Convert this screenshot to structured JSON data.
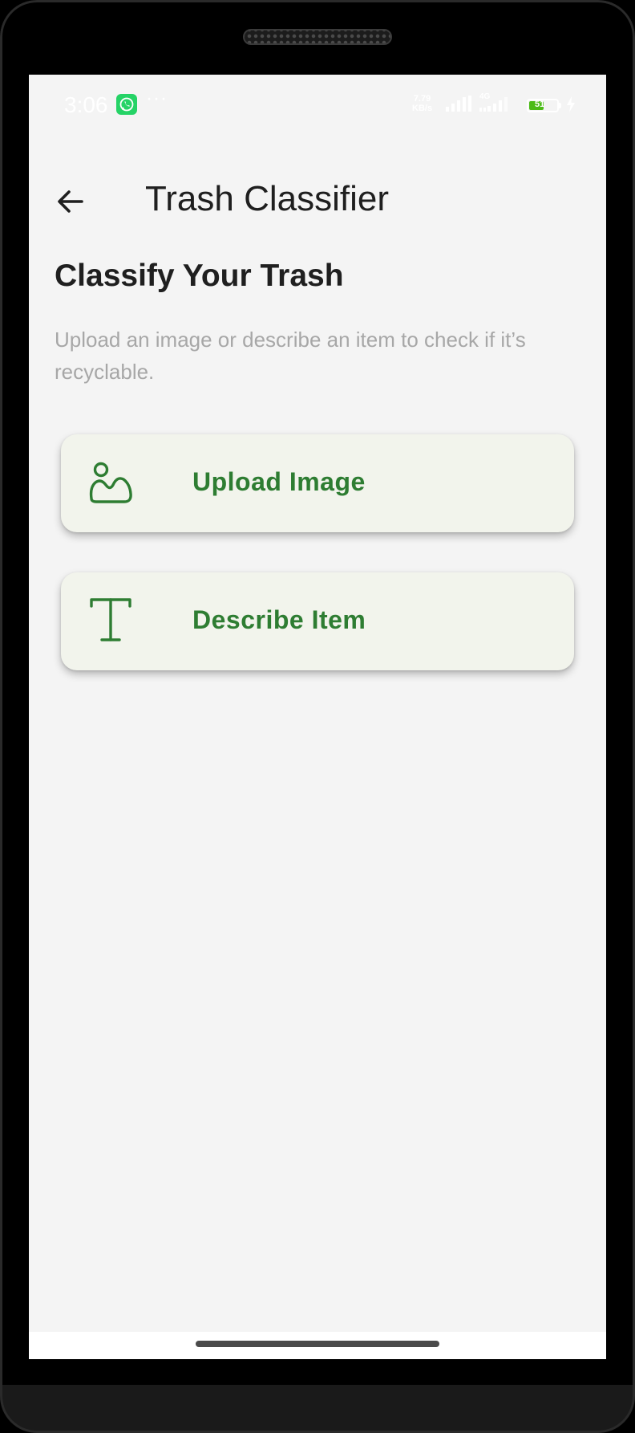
{
  "status_bar": {
    "time": "3:06",
    "notification_icon": "whatsapp-icon",
    "more_indicator": "···",
    "net_speed_value": "7.79",
    "net_speed_unit": "KB/s",
    "network_type": "4G",
    "battery_level": "51",
    "battery_fraction": 0.51,
    "battery_color": "#4cbb17"
  },
  "app_bar": {
    "back_icon": "arrow-left-icon",
    "title": "Trash Classifier"
  },
  "main": {
    "heading": "Classify Your Trash",
    "subtitle": "Upload an image or describe an item to check if it’s recyclable.",
    "options": [
      {
        "label": "Upload Image",
        "icon": "image-icon"
      },
      {
        "label": "Describe Item",
        "icon": "text-icon"
      }
    ]
  },
  "colors": {
    "accent": "#2e7d32",
    "card_background": "#f2f4ec",
    "screen_background": "#f4f4f4",
    "title_text": "#1f1f1f",
    "subtitle_text": "#a7a7a7"
  }
}
